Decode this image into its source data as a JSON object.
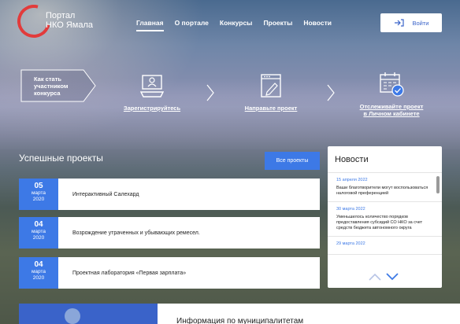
{
  "brand": {
    "line1": "Портал",
    "line2": "НКО Ямала"
  },
  "nav": {
    "items": [
      "Главная",
      "О портале",
      "Конкурсы",
      "Проекты",
      "Новости"
    ],
    "active": 0
  },
  "login": {
    "label": "Войти"
  },
  "steps": {
    "intro": {
      "line1": "Как стать",
      "line2": "участником",
      "line3": "конкурса"
    },
    "register": "Зарегистрируйтесь",
    "submit": "Направьте проект",
    "track_line1": "Отслеживайте проект",
    "track_line2": "в Личном кабинете"
  },
  "projects": {
    "title": "Успешные проекты",
    "all_button": "Все проекты",
    "items": [
      {
        "day": "05",
        "month": "марта",
        "year": "2020",
        "title": "Интерактивный Салехард"
      },
      {
        "day": "04",
        "month": "марта",
        "year": "2020",
        "title": "Возрождение утраченных и убывающих ремесел."
      },
      {
        "day": "04",
        "month": "марта",
        "year": "2020",
        "title": "Проектная лаборатория «Первая зарплата»"
      }
    ]
  },
  "news": {
    "title": "Новости",
    "items": [
      {
        "date": "15 апреля 2022",
        "text": "Ваши благотворители могут воспользоваться налоговой преференцией"
      },
      {
        "date": "30 марта 2022",
        "text": "Уменьшилось количество порядков предоставления субсидий СО НКО за счет средств бюджета автономного округа"
      },
      {
        "date": "29 марта 2022",
        "text": ""
      }
    ]
  },
  "bottom": {
    "title": "Информация по муниципалитетам"
  },
  "colors": {
    "accent": "#3d79e6",
    "logo_red": "#e23b3b",
    "login_text": "#3a63c9"
  },
  "icons": [
    "logo-ring-icon",
    "login-arrow-icon",
    "computer-user-icon",
    "document-pen-icon",
    "calendar-check-icon",
    "chevron-right-icon",
    "chevron-up-icon",
    "chevron-down-icon"
  ]
}
